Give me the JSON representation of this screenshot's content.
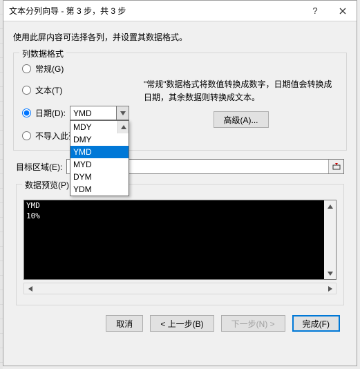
{
  "title": "文本分列向导 - 第 3 步，共 3 步",
  "instruction": "使用此屏内容可选择各列，并设置其数据格式。",
  "col_format": {
    "legend": "列数据格式",
    "general": "常规(G)",
    "text": "文本(T)",
    "date": "日期(D):",
    "skip": "不导入此列",
    "date_selected": "YMD",
    "options": [
      "MDY",
      "DMY",
      "YMD",
      "MYD",
      "DYM",
      "YDM"
    ],
    "hover_index": 2,
    "description": "\"常规\"数据格式将数值转换成数字，日期值会转换成日期，其余数据则转换成文本。",
    "advanced": "高级(A)..."
  },
  "target": {
    "label": "目标区域(E):",
    "value": "$"
  },
  "preview": {
    "legend": "数据预览(P)",
    "header_type": "YMD",
    "rows": [
      "10%"
    ]
  },
  "footer": {
    "cancel": "取消",
    "back": "< 上一步(B)",
    "next": "下一步(N) >",
    "finish": "完成(F)"
  }
}
